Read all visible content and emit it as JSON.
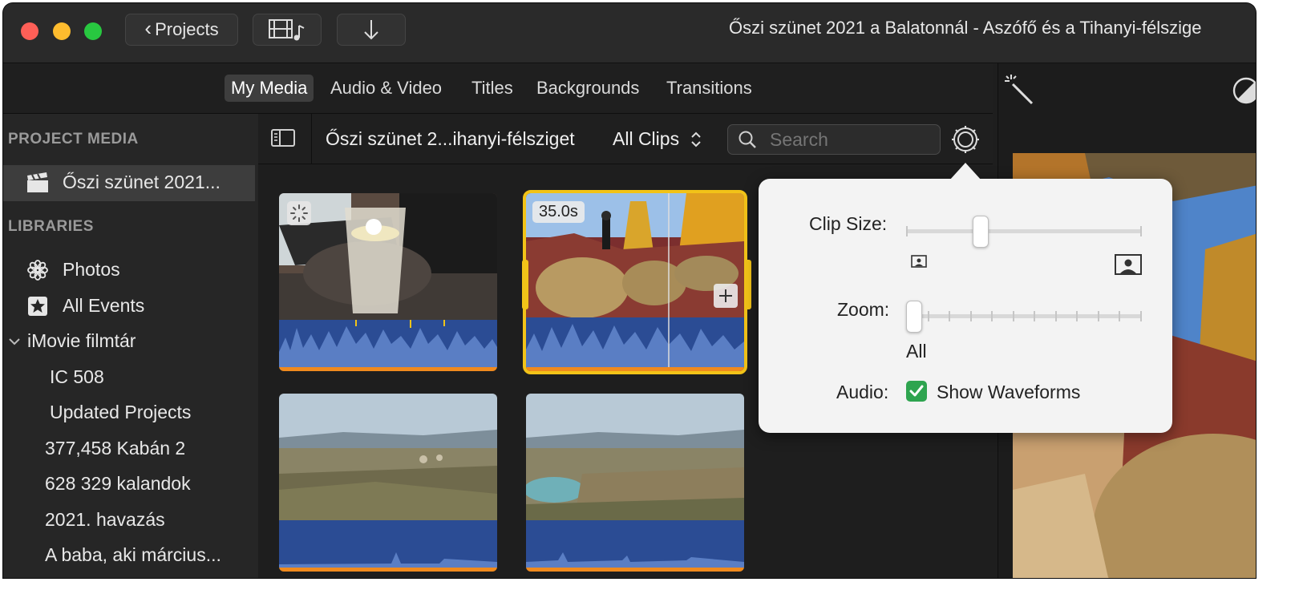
{
  "window": {
    "title": "Őszi szünet 2021 a Balatonnál - Aszófő és a Tihanyi-félszige",
    "back_button_label": "Projects"
  },
  "tabs": [
    "My Media",
    "Audio & Video",
    "Titles",
    "Backgrounds",
    "Transitions"
  ],
  "sidebar": {
    "project_media_header": "PROJECT MEDIA",
    "project_item": "Őszi szünet 2021...",
    "libraries_header": "LIBRARIES",
    "libraries": [
      {
        "label": "Photos",
        "icon": "flower-icon"
      },
      {
        "label": "All Events",
        "icon": "star-icon"
      },
      {
        "label": "iMovie filmtár",
        "icon": "chevron-down-icon"
      }
    ],
    "events": [
      "IC 508",
      "Updated Projects",
      "377,458 Kabán 2",
      "628 329 kalandok",
      "2021. havazás",
      "A baba, aki március..."
    ]
  },
  "browser": {
    "event_title": "Őszi szünet 2...ihanyi-félsziget",
    "filter_label": "All Clips",
    "search_placeholder": "Search"
  },
  "clips": [
    {
      "badge": "",
      "selected": false
    },
    {
      "badge": "35.0s",
      "selected": true
    },
    {
      "badge": "",
      "selected": false
    },
    {
      "badge": "",
      "selected": false
    }
  ],
  "popover": {
    "clip_size_label": "Clip Size:",
    "clip_size_value": 0.3,
    "zoom_label": "Zoom:",
    "zoom_value": 0,
    "zoom_value_text": "All",
    "audio_label": "Audio:",
    "waveforms_label": "Show Waveforms",
    "waveforms_checked": true
  },
  "colors": {
    "accent_selection": "#f2c318",
    "waveform": "#2b4c94",
    "audio_bar": "#f08a1e",
    "checkbox": "#28a745"
  }
}
